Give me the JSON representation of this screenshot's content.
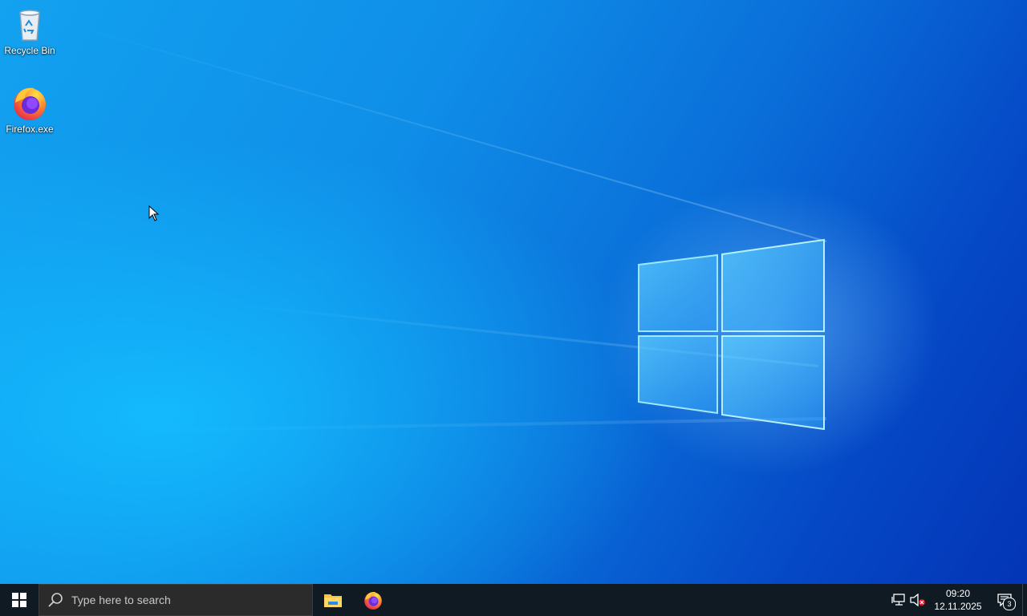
{
  "desktop": {
    "icons": [
      {
        "label": "Recycle Bin",
        "icon": "recycle-bin-icon"
      },
      {
        "label": "Firefox.exe",
        "icon": "firefox-icon"
      }
    ],
    "wallpaper": "windows-10-hero",
    "accent_color": "#0a78e6"
  },
  "taskbar": {
    "search_placeholder": "Type here to search",
    "pinned_apps": [
      {
        "name": "File Explorer",
        "icon": "file-explorer-icon"
      },
      {
        "name": "Firefox",
        "icon": "firefox-icon"
      }
    ],
    "tray": {
      "network_icon": "network-icon",
      "volume_icon": "volume-muted-icon",
      "time": "09:20",
      "date": "12.11.2025",
      "notification_count": "3"
    },
    "background_color": "#101a22"
  }
}
